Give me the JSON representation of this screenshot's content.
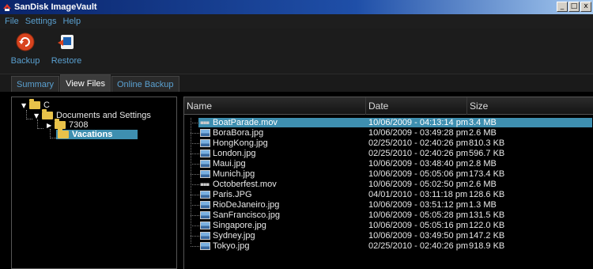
{
  "window": {
    "title": "SanDisk ImageVault",
    "buttons": [
      "_",
      "□",
      "x"
    ]
  },
  "menu": [
    "File",
    "Settings",
    "Help"
  ],
  "toolbar": {
    "backup_label": "Backup",
    "restore_label": "Restore"
  },
  "tabs": [
    {
      "label": "Summary",
      "active": false
    },
    {
      "label": "View Files",
      "active": true
    },
    {
      "label": "Online Backup",
      "active": false
    }
  ],
  "tree": {
    "root": "C",
    "documents": "Documents and Settings",
    "user": "7308",
    "selected": "Vacations"
  },
  "file_list": {
    "columns": [
      "Name",
      "Date",
      "Size"
    ],
    "rows": [
      {
        "name": "BoatParade.mov",
        "date": "10/06/2009 - 04:13:14 pm",
        "size": "3.4 MB",
        "type": "movie",
        "selected": true
      },
      {
        "name": "BoraBora.jpg",
        "date": "10/06/2009 - 03:49:28 pm",
        "size": "2.6 MB",
        "type": "image"
      },
      {
        "name": "HongKong.jpg",
        "date": "02/25/2010 - 02:40:26 pm",
        "size": "810.3 KB",
        "type": "image"
      },
      {
        "name": "London.jpg",
        "date": "02/25/2010 - 02:40:26 pm",
        "size": "596.7 KB",
        "type": "image"
      },
      {
        "name": "Maui.jpg",
        "date": "10/06/2009 - 03:48:40 pm",
        "size": "2.8 MB",
        "type": "image"
      },
      {
        "name": "Munich.jpg",
        "date": "10/06/2009 - 05:05:06 pm",
        "size": "173.4 KB",
        "type": "image"
      },
      {
        "name": "Octoberfest.mov",
        "date": "10/06/2009 - 05:02:50 pm",
        "size": "2.6 MB",
        "type": "movie"
      },
      {
        "name": "Paris.JPG",
        "date": "04/01/2010 - 03:11:18 pm",
        "size": "128.6 KB",
        "type": "image"
      },
      {
        "name": "RioDeJaneiro.jpg",
        "date": "10/06/2009 - 03:51:12 pm",
        "size": "1.3 MB",
        "type": "image"
      },
      {
        "name": "SanFrancisco.jpg",
        "date": "10/06/2009 - 05:05:28 pm",
        "size": "131.5 KB",
        "type": "image"
      },
      {
        "name": "Singapore.jpg",
        "date": "10/06/2009 - 05:05:16 pm",
        "size": "122.0 KB",
        "type": "image"
      },
      {
        "name": "Sydney.jpg",
        "date": "10/06/2009 - 03:49:50 pm",
        "size": "147.2 KB",
        "type": "image"
      },
      {
        "name": "Tokyo.jpg",
        "date": "02/25/2010 - 02:40:26 pm",
        "size": "918.9 KB",
        "type": "image"
      }
    ]
  },
  "colors": {
    "accent": "#3e8fb0",
    "link": "#5aa0d0",
    "background": "#000000",
    "folder": "#e8c24a"
  }
}
